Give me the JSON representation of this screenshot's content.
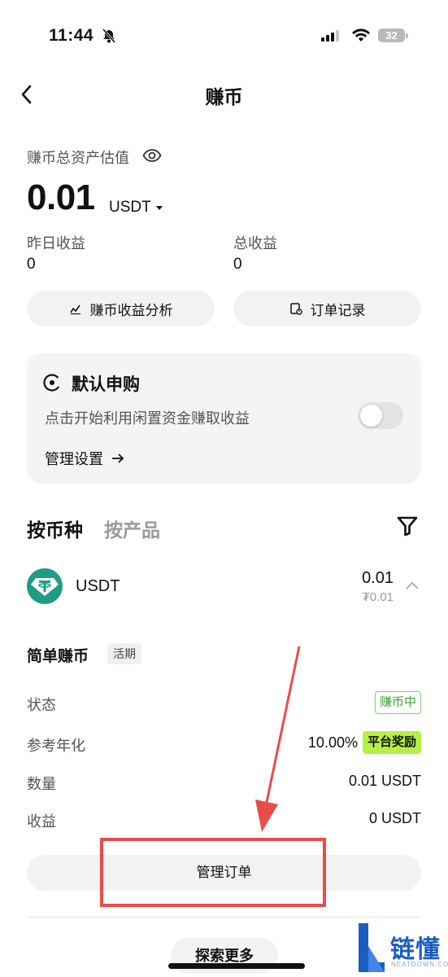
{
  "status_bar": {
    "time": "11:44",
    "battery": "32"
  },
  "nav": {
    "title": "赚币"
  },
  "assets": {
    "label": "赚币总资产估值",
    "value": "0.01",
    "unit": "USDT",
    "yesterday_label": "昨日收益",
    "yesterday_value": "0",
    "total_label": "总收益",
    "total_value": "0"
  },
  "actions": {
    "analysis": "赚币收益分析",
    "orders": "订单记录"
  },
  "default_card": {
    "title": "默认申购",
    "desc": "点击开始利用闲置资金赚取收益",
    "link": "管理设置"
  },
  "tabs": {
    "active": "按币种",
    "inactive": "按产品"
  },
  "coin": {
    "name": "USDT",
    "amount": "0.01",
    "fiat": "₮0.01"
  },
  "product": {
    "title": "简单赚币",
    "badge": "活期",
    "rows": {
      "status_label": "状态",
      "status_value": "赚币中",
      "apr_label": "参考年化",
      "apr_value": "10.00%",
      "apr_badge": "平台奖励",
      "qty_label": "数量",
      "qty_value": "0.01 USDT",
      "earn_label": "收益",
      "earn_value": "0 USDT"
    },
    "manage": "管理订单"
  },
  "explore": "探索更多",
  "watermark": {
    "text": "链懂",
    "sub": "NEATDOWN.COM"
  },
  "colors": {
    "accent_green": "#b6f046",
    "coin_green": "#1f9c86",
    "annotation_red": "#ea4b4b"
  }
}
